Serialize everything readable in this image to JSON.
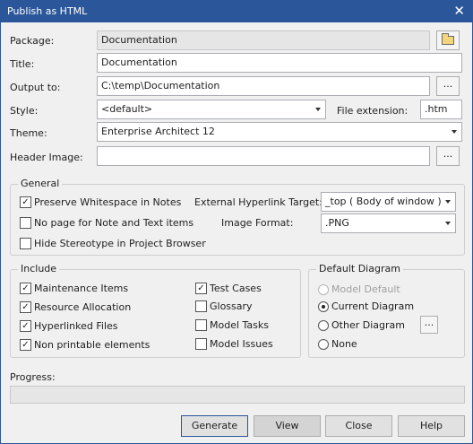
{
  "window": {
    "title": "Publish as HTML",
    "close_glyph": "✕"
  },
  "form": {
    "package_label": "Package:",
    "package_value": "Documentation",
    "title_label": "Title:",
    "title_value": "Documentation",
    "output_label": "Output to:",
    "output_value": "C:\\temp\\Documentation",
    "style_label": "Style:",
    "style_value": "<default>",
    "file_ext_label": "File extension:",
    "file_ext_value": ".htm",
    "theme_label": "Theme:",
    "theme_value": "Enterprise Architect 12",
    "header_image_label": "Header Image:",
    "header_image_value": "",
    "browse_glyph": "..."
  },
  "general": {
    "legend": "General",
    "preserve_whitespace": {
      "label": "Preserve Whitespace in Notes",
      "checked": true
    },
    "no_page_notes": {
      "label": "No page for Note and Text items",
      "checked": false
    },
    "hide_stereotype": {
      "label": "Hide Stereotype in Project Browser",
      "checked": false
    },
    "ext_hyperlink_label": "External Hyperlink Target:",
    "ext_hyperlink_value": "_top  ( Body of window )",
    "image_format_label": "Image Format:",
    "image_format_value": ".PNG"
  },
  "include": {
    "legend": "Include",
    "items": [
      {
        "label": "Maintenance Items",
        "checked": true
      },
      {
        "label": "Resource Allocation",
        "checked": true
      },
      {
        "label": "Hyperlinked Files",
        "checked": true
      },
      {
        "label": "Non printable elements",
        "checked": true
      },
      {
        "label": "Test Cases",
        "checked": true
      },
      {
        "label": "Glossary",
        "checked": false
      },
      {
        "label": "Model Tasks",
        "checked": false
      },
      {
        "label": "Model Issues",
        "checked": false
      }
    ]
  },
  "default_diagram": {
    "legend": "Default Diagram",
    "options": [
      {
        "label": "Model Default",
        "selected": false,
        "disabled": true
      },
      {
        "label": "Current Diagram",
        "selected": true,
        "disabled": false
      },
      {
        "label": "Other Diagram",
        "selected": false,
        "disabled": false
      },
      {
        "label": "None",
        "selected": false,
        "disabled": false
      }
    ]
  },
  "progress": {
    "label": "Progress:",
    "value": 0
  },
  "buttons": {
    "generate": "Generate",
    "view": "View",
    "close": "Close",
    "help": "Help"
  },
  "check_glyph": "✓"
}
